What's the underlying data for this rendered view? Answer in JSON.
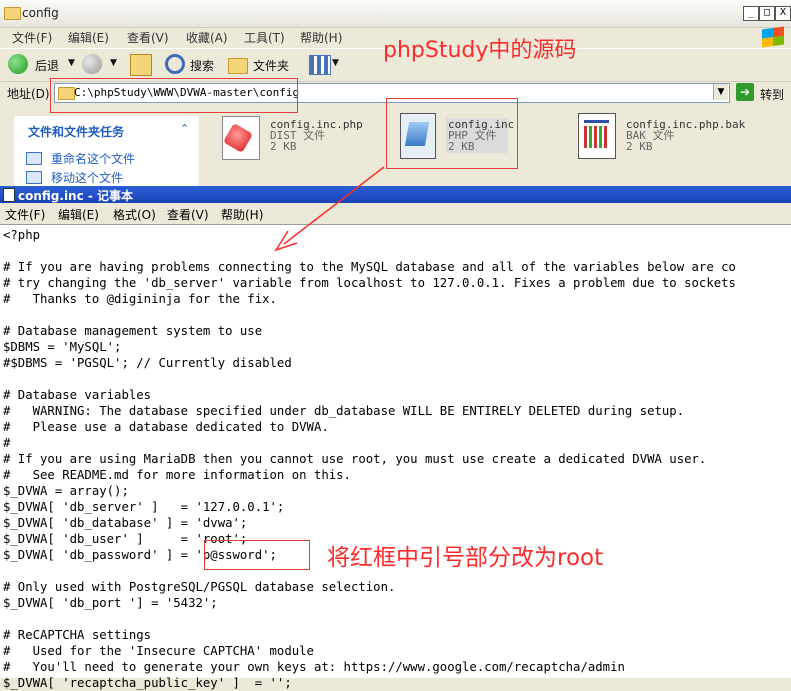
{
  "explorer": {
    "title": "config",
    "window_buttons": [
      "_",
      "□",
      "X"
    ],
    "menu": [
      "文件(F)",
      "编辑(E)",
      "查看(V)",
      "收藏(A)",
      "工具(T)",
      "帮助(H)"
    ],
    "toolbar": {
      "back": "后退",
      "search": "搜索",
      "folders": "文件夹"
    },
    "address": {
      "label": "地址(D)",
      "value": "C:\\phpStudy\\WWW\\DVWA-master\\config",
      "go": "转到"
    },
    "tasks": {
      "title": "文件和文件夹任务",
      "items": [
        "重命名这个文件",
        "移动这个文件"
      ]
    },
    "files": [
      {
        "name": "config.inc.php",
        "type": "DIST 文件",
        "size": "2 KB"
      },
      {
        "name": "config.inc",
        "type": "PHP 文件",
        "size": "2 KB"
      },
      {
        "name": "config.inc.php.bak",
        "type": "BAK 文件",
        "size": "2 KB"
      }
    ]
  },
  "notepad": {
    "title": "config.inc - 记事本",
    "menu": [
      "文件(F)",
      "编辑(E)",
      "格式(O)",
      "查看(V)",
      "帮助(H)"
    ],
    "content": "<?php\n\n# If you are having problems connecting to the MySQL database and all of the variables below are co\n# try changing the 'db_server' variable from localhost to 127.0.0.1. Fixes a problem due to sockets\n#   Thanks to @digininja for the fix.\n\n# Database management system to use\n$DBMS = 'MySQL';\n#$DBMS = 'PGSQL'; // Currently disabled\n\n# Database variables\n#   WARNING: The database specified under db_database WILL BE ENTIRELY DELETED during setup.\n#   Please use a database dedicated to DVWA.\n#\n# If you are using MariaDB then you cannot use root, you must use create a dedicated DVWA user.\n#   See README.md for more information on this.\n$_DVWA = array();\n$_DVWA[ 'db_server' ]   = '127.0.0.1';\n$_DVWA[ 'db_database' ] = 'dvwa';\n$_DVWA[ 'db_user' ]     = 'root';\n$_DVWA[ 'db_password' ] = 'p@ssword';\n\n# Only used with PostgreSQL/PGSQL database selection.\n$_DVWA[ 'db_port '] = '5432';\n\n# ReCAPTCHA settings\n#   Used for the 'Insecure CAPTCHA' module\n#   You'll need to generate your own keys at: https://www.google.com/recaptcha/admin\n$_DVWA[ 'recaptcha_public_key' ]  = '';"
  },
  "annotations": {
    "top": "phpStudy中的源码",
    "bottom": "将红框中引号部分改为root"
  },
  "colors": {
    "annotation": "#ff2b2b",
    "notepad_title": "#2a5fd6"
  }
}
